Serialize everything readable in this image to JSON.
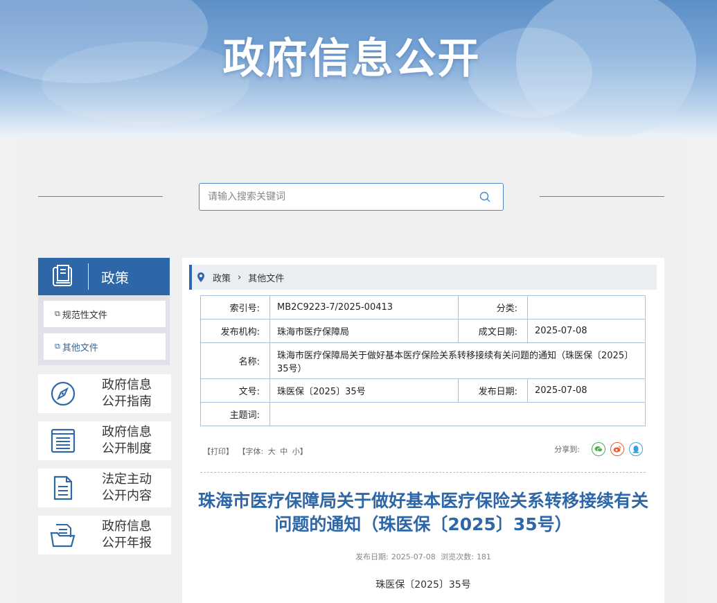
{
  "banner": {
    "title": "政府信息公开"
  },
  "search": {
    "placeholder": "请输入搜索关键词"
  },
  "sidebar": {
    "header": "政策",
    "sub_items": [
      {
        "label": "规范性文件",
        "icon": "document-copy-icon"
      },
      {
        "label": "其他文件",
        "icon": "document-copy-icon"
      }
    ],
    "cards": [
      {
        "line1": "政府信息",
        "line2": "公开指南",
        "icon": "compass-icon"
      },
      {
        "line1": "政府信息",
        "line2": "公开制度",
        "icon": "list-document-icon"
      },
      {
        "line1": "法定主动",
        "line2": "公开内容",
        "icon": "file-text-icon"
      },
      {
        "line1": "政府信息",
        "line2": "公开年报",
        "icon": "folder-open-icon"
      }
    ]
  },
  "breadcrumb": {
    "items": [
      "政策",
      "其他文件"
    ]
  },
  "meta_table": {
    "index_label": "索引号:",
    "index_value": "MB2C9223-7/2025-00413",
    "category_label": "分类:",
    "category_value": "",
    "issuer_label": "发布机构:",
    "issuer_value": "珠海市医疗保障局",
    "created_label": "成文日期:",
    "created_value": "2025-07-08",
    "name_label": "名称:",
    "name_value": "珠海市医疗保障局关于做好基本医疗保险关系转移接续有关问题的通知（珠医保〔2025〕35号）",
    "docno_label": "文号:",
    "docno_value": "珠医保〔2025〕35号",
    "published_label": "发布日期:",
    "published_value": "2025-07-08",
    "keywords_label": "主题词:",
    "keywords_value": ""
  },
  "tools": {
    "print": "【打印】",
    "font_label": "【字体:",
    "font_large": "大",
    "font_medium": "中",
    "font_small": "小】",
    "share_label": "分享到:",
    "share_icons": [
      "wechat-icon",
      "weibo-icon",
      "qq-icon"
    ],
    "share_colors": {
      "wechat": "#4caf50",
      "weibo": "#e8612c",
      "qq": "#3aa0e0"
    }
  },
  "article": {
    "title": "珠海市医疗保障局关于做好基本医疗保险关系转移接续有关问题的通知（珠医保〔2025〕35号）",
    "publish_label": "发布日期:",
    "publish_date": "2025-07-08",
    "views_label": "浏览次数:",
    "views": "181",
    "doc_number": "珠医保〔2025〕35号"
  },
  "colors": {
    "accent": "#2e67a8",
    "border": "#a6c4de",
    "panel": "#f0f0f0"
  }
}
